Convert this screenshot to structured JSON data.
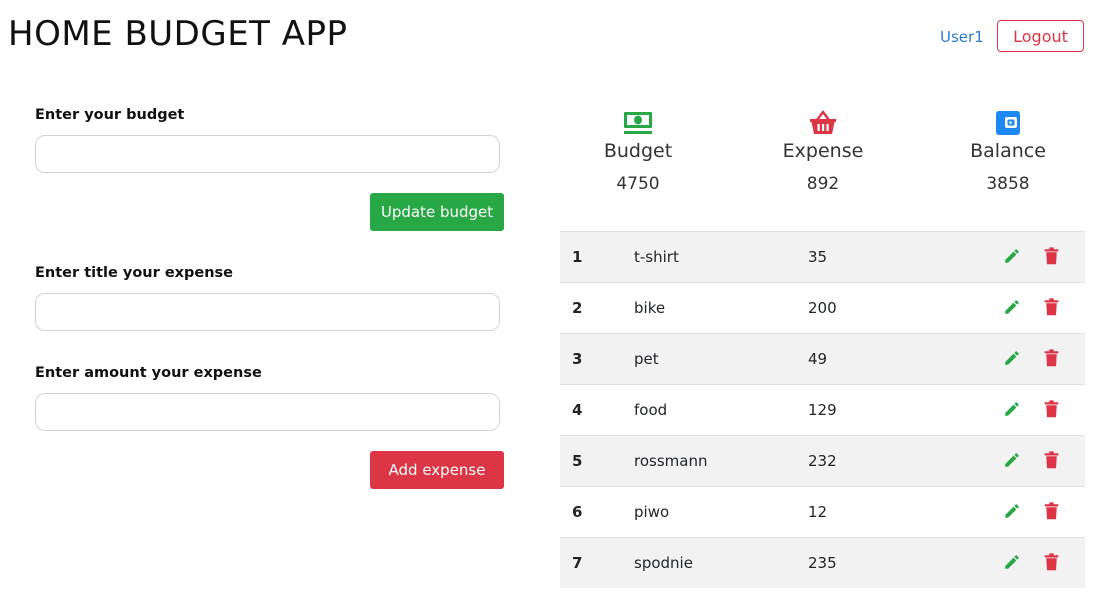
{
  "header": {
    "title": "HOME BUDGET APP",
    "user_label": "User1",
    "logout_label": "Logout"
  },
  "form": {
    "budget_label": "Enter your budget",
    "budget_value": "",
    "update_budget_label": "Update budget",
    "expense_title_label": "Enter title your expense",
    "expense_title_value": "",
    "expense_amount_label": "Enter amount your expense",
    "expense_amount_value": "",
    "add_expense_label": "Add expense"
  },
  "summary": {
    "budget": {
      "label": "Budget",
      "value": "4750",
      "icon": "cash-icon"
    },
    "expense": {
      "label": "Expense",
      "value": "892",
      "icon": "basket-icon"
    },
    "balance": {
      "label": "Balance",
      "value": "3858",
      "icon": "wallet-icon"
    }
  },
  "expenses": [
    {
      "num": "1",
      "title": "t-shirt",
      "amount": "35"
    },
    {
      "num": "2",
      "title": "bike",
      "amount": "200"
    },
    {
      "num": "3",
      "title": "pet",
      "amount": "49"
    },
    {
      "num": "4",
      "title": "food",
      "amount": "129"
    },
    {
      "num": "5",
      "title": "rossmann",
      "amount": "232"
    },
    {
      "num": "6",
      "title": "piwo",
      "amount": "12"
    },
    {
      "num": "7",
      "title": "spodnie",
      "amount": "235"
    }
  ],
  "colors": {
    "success": "#28a745",
    "danger": "#dc3545",
    "link": "#2a7bd4",
    "wallet": "#1e88f5"
  }
}
